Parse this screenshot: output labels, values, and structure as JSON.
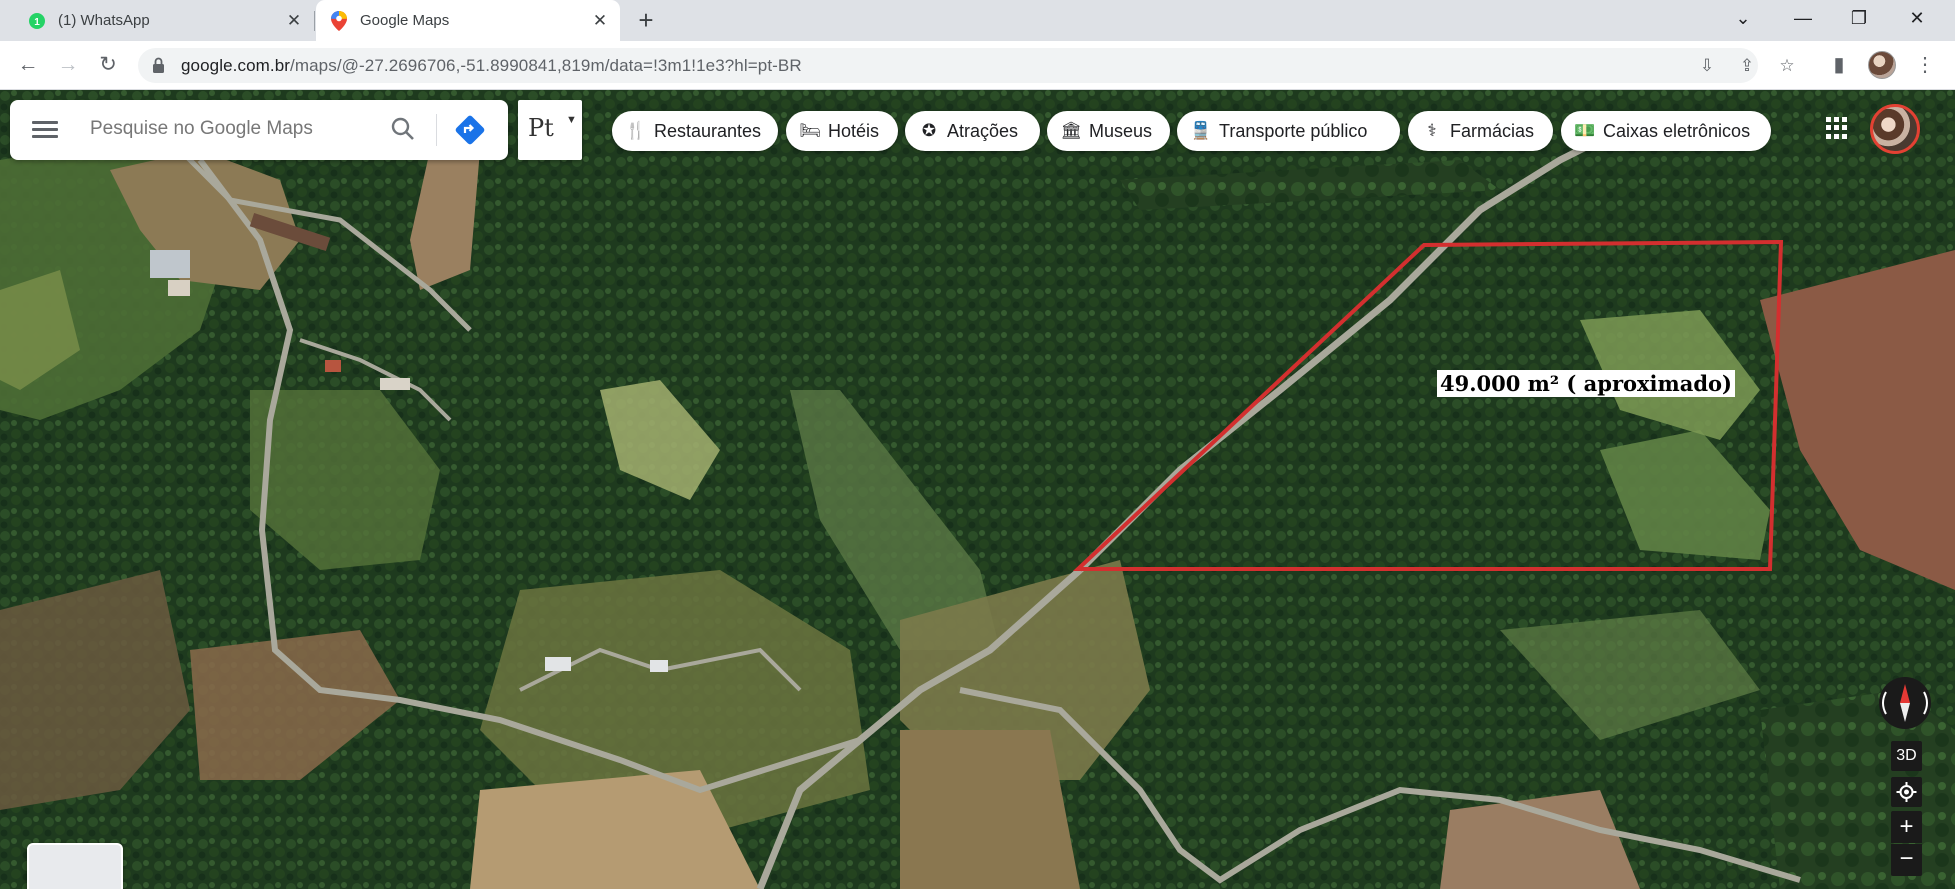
{
  "browser": {
    "tabs": [
      {
        "title": "(1) WhatsApp",
        "favicon": "whatsapp-icon",
        "active": false
      },
      {
        "title": "Google Maps",
        "favicon": "google-maps-icon",
        "active": true
      }
    ],
    "new_tab_symbol": "+",
    "url": {
      "host": "google.com.br",
      "path": "/maps/@-27.2696706,-51.8990841,819m/data=!3m1!1e3?hl=pt-BR"
    }
  },
  "maps": {
    "search_placeholder": "Pesquise no Google Maps",
    "language_indicator": "Pt",
    "chips": [
      {
        "label": "Restaurantes",
        "icon": "fork-knife-icon"
      },
      {
        "label": "Hotéis",
        "icon": "bed-icon"
      },
      {
        "label": "Atrações",
        "icon": "attraction-icon"
      },
      {
        "label": "Museus",
        "icon": "museum-icon"
      },
      {
        "label": "Transporte público",
        "icon": "train-icon"
      },
      {
        "label": "Farmácias",
        "icon": "pharmacy-icon"
      },
      {
        "label": "Caixas eletrônicos",
        "icon": "atm-icon"
      }
    ],
    "annotation_label": "49.000 m² ( aproximado)",
    "controls": {
      "btn_3d": "3D",
      "zoom_in": "+",
      "zoom_out": "−"
    }
  },
  "colors": {
    "boundary": "#d32f2f",
    "directions_blue": "#1a73e8",
    "forest": "#1f3a1e"
  }
}
